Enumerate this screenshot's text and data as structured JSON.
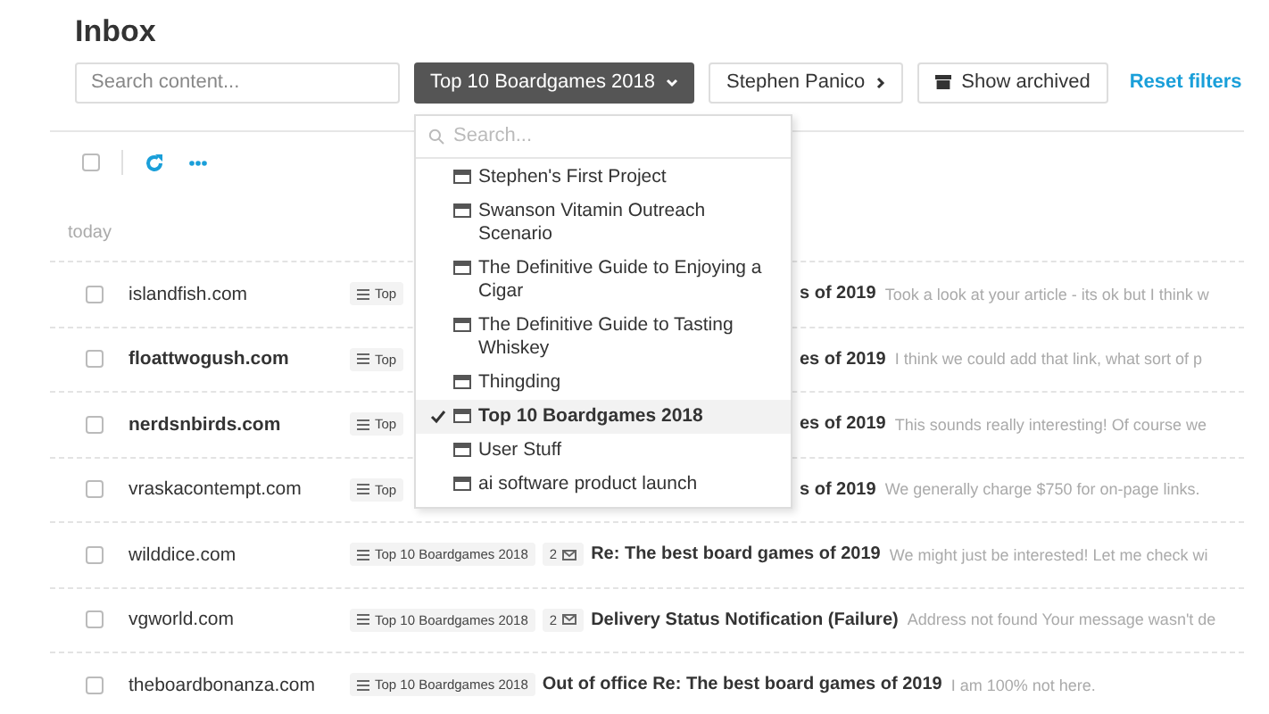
{
  "title": "Inbox",
  "filters": {
    "search": {
      "placeholder": "Search content..."
    },
    "project": {
      "label": "Top 10 Boardgames 2018",
      "expanded": true
    },
    "person": {
      "label": "Stephen Panico"
    },
    "archived": {
      "label": "Show archived"
    },
    "reset": {
      "label": "Reset filters"
    }
  },
  "dropdown": {
    "search": {
      "placeholder": "Search..."
    },
    "items": [
      {
        "label": "Stephen's First Project",
        "selected": false
      },
      {
        "label": "Swanson Vitamin Outreach Scenario",
        "selected": false
      },
      {
        "label": "The Definitive Guide to Enjoying a Cigar",
        "selected": false
      },
      {
        "label": "The Definitive Guide to Tasting Whiskey",
        "selected": false
      },
      {
        "label": "Thingding",
        "selected": false
      },
      {
        "label": "Top 10 Boardgames 2018",
        "selected": true
      },
      {
        "label": "User Stuff",
        "selected": false
      },
      {
        "label": "ai software product launch",
        "selected": false
      }
    ]
  },
  "toolbar": {
    "select_all": {
      "checked": false
    }
  },
  "group": "today",
  "rows": [
    {
      "kind": "partial",
      "checked": false,
      "unread": false,
      "name": "islandfish.com",
      "tag": "Top",
      "subject": "s of 2019",
      "preview": "Took a look at your article - its ok but I think w"
    },
    {
      "kind": "partial",
      "checked": false,
      "unread": true,
      "name": "floattwogush.com",
      "tag": "Top",
      "subject": "es of 2019",
      "preview": "I think we could add that link, what sort of p"
    },
    {
      "kind": "partial",
      "checked": false,
      "unread": true,
      "name": "nerdsnbirds.com",
      "tag": "Top",
      "subject": "es of 2019",
      "preview": "This sounds really interesting! Of course we"
    },
    {
      "kind": "partial",
      "checked": false,
      "unread": false,
      "name": "vraskacontempt.com",
      "tag": "Top",
      "subject": "s of 2019",
      "preview": "We generally charge $750 for on-page links."
    },
    {
      "kind": "full",
      "checked": false,
      "unread": false,
      "name": "wilddice.com",
      "tag": "Top 10 Boardgames 2018",
      "count": "2",
      "subject": "Re: The best board games of 2019",
      "preview": "We might just be interested! Let me check wi"
    },
    {
      "kind": "full",
      "checked": false,
      "unread": false,
      "name": "vgworld.com",
      "tag": "Top 10 Boardgames 2018",
      "count": "2",
      "subject": "Delivery Status Notification (Failure)",
      "preview": "Address not found Your message wasn't de"
    },
    {
      "kind": "full",
      "checked": false,
      "unread": false,
      "name": "theboardbonanza.com",
      "tag": "Top 10 Boardgames 2018",
      "subject": "Out of office Re: The best board games of 2019",
      "preview": "I am 100% not here."
    }
  ]
}
